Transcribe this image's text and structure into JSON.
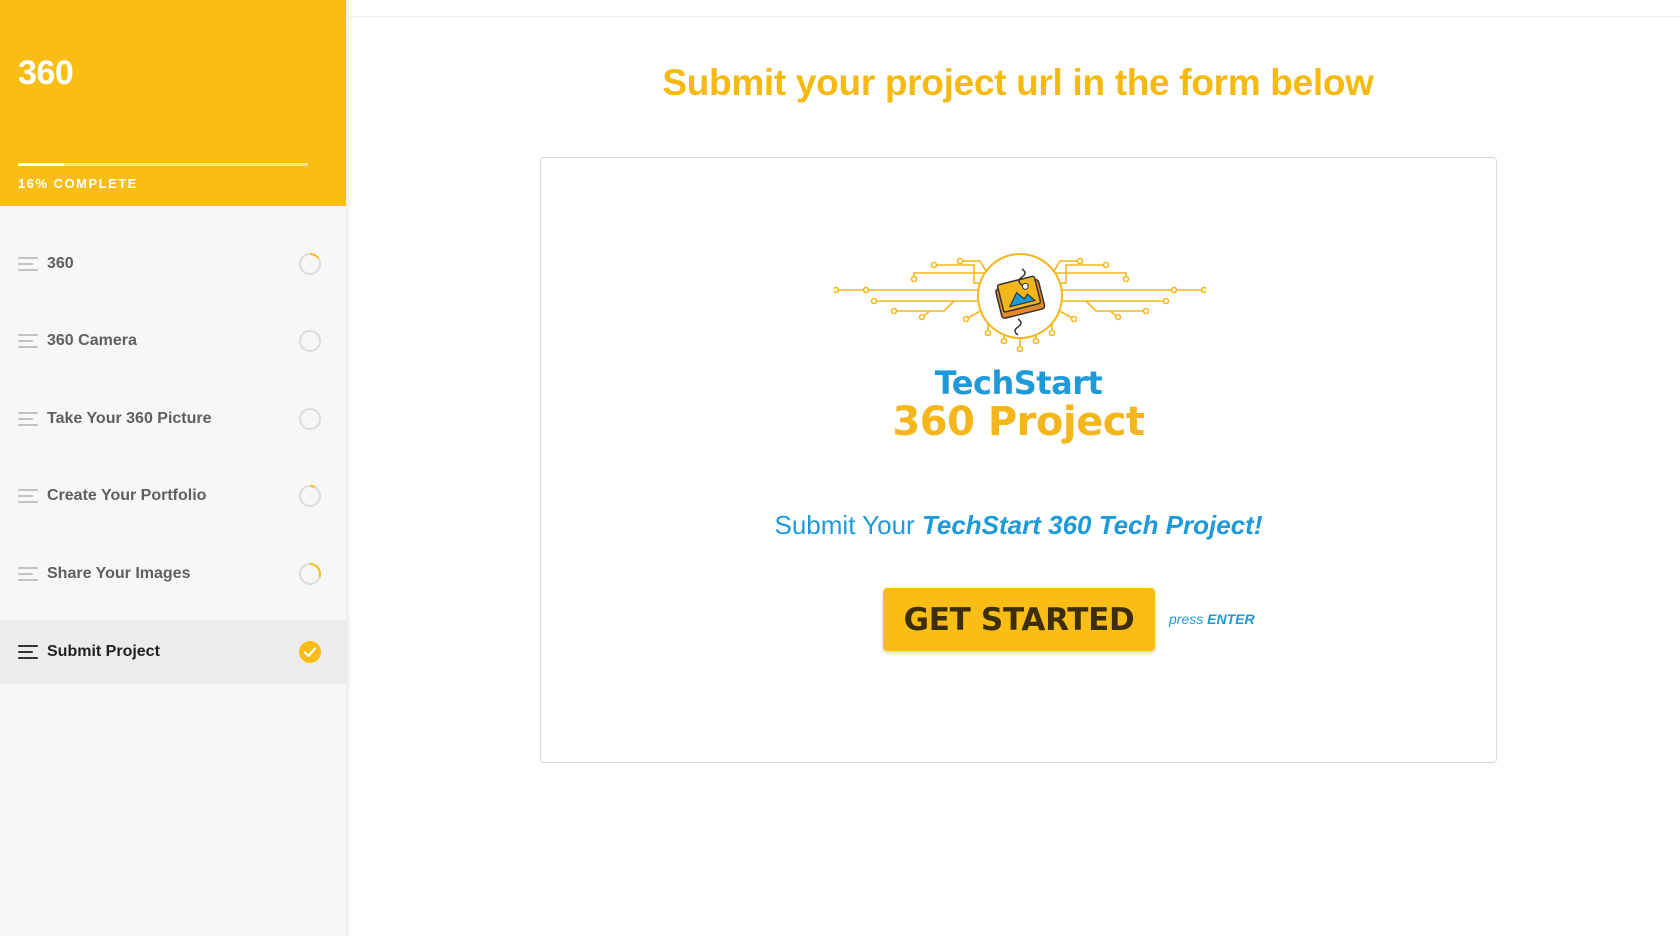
{
  "sidebar": {
    "course_title": "360",
    "progress_percent": 16,
    "progress_label": "16% COMPLETE",
    "lessons": [
      {
        "label": "360",
        "status": "partial",
        "progress": 0.15
      },
      {
        "label": "360 Camera",
        "status": "not-started",
        "progress": 0
      },
      {
        "label": "Take Your 360 Picture",
        "status": "not-started",
        "progress": 0
      },
      {
        "label": "Create Your Portfolio",
        "status": "partial",
        "progress": 0.08
      },
      {
        "label": "Share Your Images",
        "status": "partial",
        "progress": 0.3
      },
      {
        "label": "Submit Project",
        "status": "complete",
        "progress": 1,
        "active": true
      }
    ]
  },
  "main": {
    "title": "Submit your project url in the form below",
    "card": {
      "logo_line1": "TechStart",
      "logo_line2": "360 Project",
      "prompt_prefix": "Submit Your",
      "prompt_emphasis": "TechStart 360 Tech Project!",
      "button_label": "GET STARTED",
      "hint_press": "press",
      "hint_key": "ENTER"
    }
  },
  "colors": {
    "accent_yellow": "#f9bd16",
    "title_yellow": "#f5b90f",
    "brand_blue": "#1e9ad8"
  },
  "icons": {
    "lesson": "lines-icon",
    "partial": "progress-ring-icon",
    "not_started": "empty-circle-icon",
    "complete": "check-circle-icon",
    "logo": "circuit-book-icon"
  }
}
